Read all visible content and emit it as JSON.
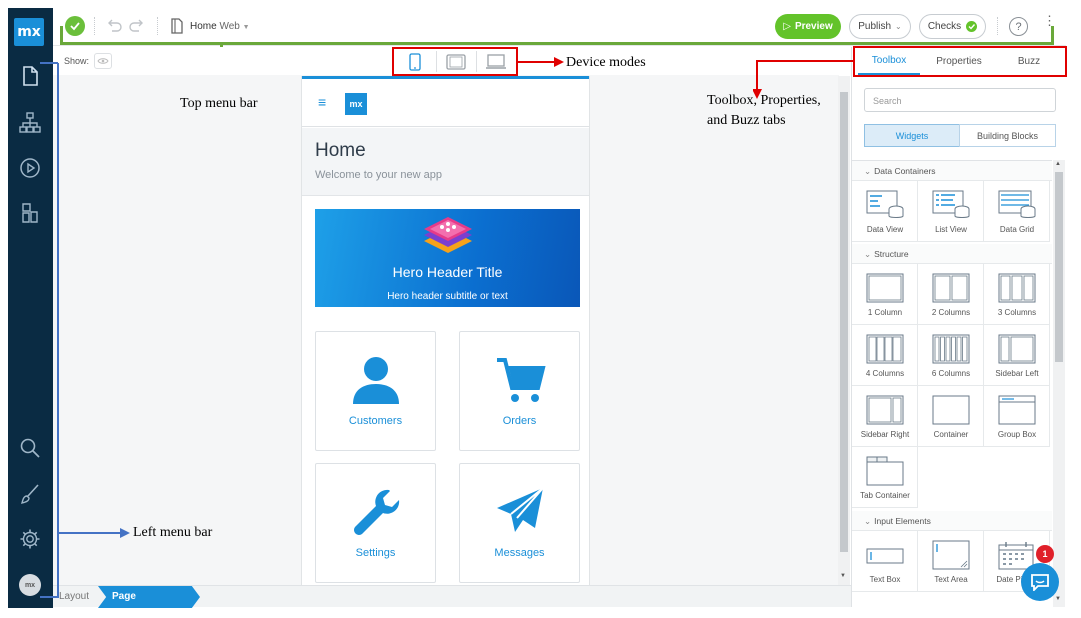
{
  "app": {
    "logo_text": "mx"
  },
  "topbar": {
    "document_name": "Home",
    "document_profile": "Web",
    "preview_label": "Preview",
    "publish_label": "Publish",
    "checks_label": "Checks",
    "help_label": "?"
  },
  "toolbar": {
    "show_label": "Show:"
  },
  "canvas": {
    "page_title": "Home",
    "page_subtitle": "Welcome to your new app",
    "hero_title": "Hero Header Title",
    "hero_subtitle": "Hero header subtitle or text",
    "phone_logo": "mx",
    "tiles": [
      {
        "label": "Customers",
        "icon": "person-icon"
      },
      {
        "label": "Orders",
        "icon": "cart-icon"
      },
      {
        "label": "Settings",
        "icon": "wrench-icon"
      },
      {
        "label": "Messages",
        "icon": "paper-plane-icon"
      }
    ]
  },
  "breadcrumb": {
    "layout": "Layout",
    "page": "Page"
  },
  "right_panel": {
    "tabs": [
      "Toolbox",
      "Properties",
      "Buzz"
    ],
    "active_tab": "Toolbox",
    "search_placeholder": "Search",
    "segments": [
      "Widgets",
      "Building Blocks"
    ],
    "sections": [
      {
        "title": "Data Containers",
        "items": [
          "Data View",
          "List View",
          "Data Grid"
        ]
      },
      {
        "title": "Structure",
        "items": [
          "1 Column",
          "2 Columns",
          "3 Columns",
          "4 Columns",
          "6 Columns",
          "Sidebar Left",
          "Sidebar Right",
          "Container",
          "Group Box",
          "Tab Container"
        ]
      },
      {
        "title": "Input Elements",
        "items": [
          "Text Box",
          "Text Area",
          "Date Picker"
        ]
      }
    ],
    "chat_badge": "1"
  },
  "user": {
    "avatar_text": "mx"
  },
  "annotations": {
    "top_menu_bar": "Top menu bar",
    "device_modes": "Device modes",
    "tabs_line1": "Toolbox, Properties,",
    "tabs_line2": "and Buzz tabs",
    "left_menu_bar": "Left menu bar"
  },
  "colors": {
    "accent": "#1a8fd8",
    "sidebar": "#0a2b43",
    "preview": "#63c32a",
    "annotation_red": "#e00000",
    "annotation_green": "#6aa83a",
    "annotation_blue": "#4472c4"
  }
}
